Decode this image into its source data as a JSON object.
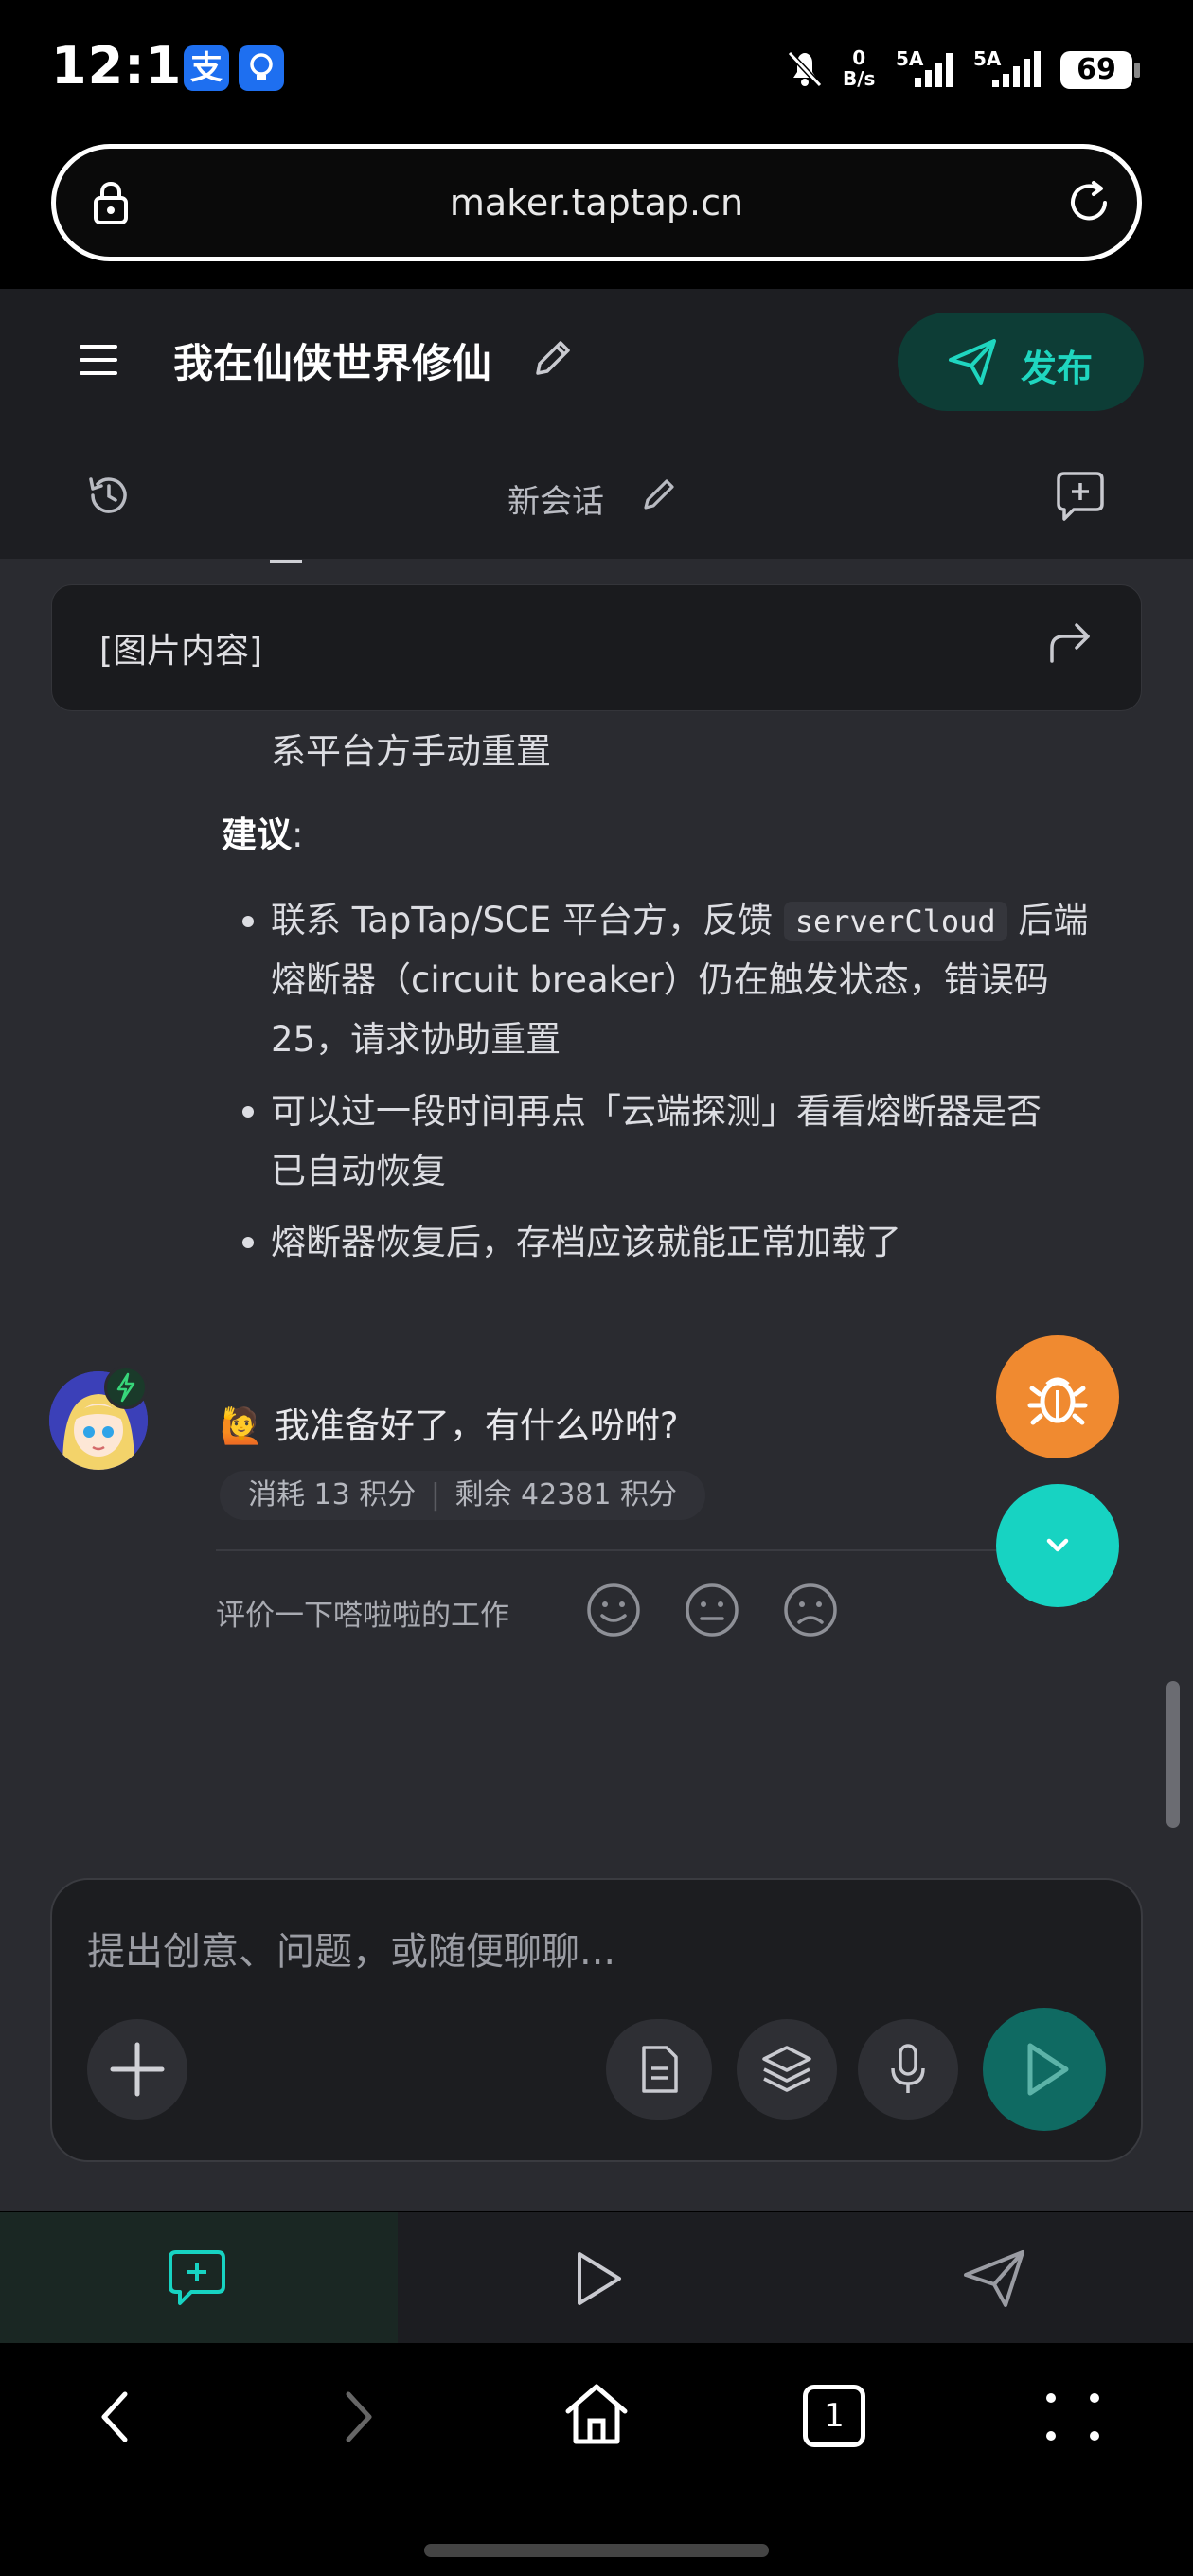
{
  "status_bar": {
    "time": "12:18",
    "app_icons": [
      "支",
      "lightbulb-icon"
    ],
    "net_speed_value": "0",
    "net_speed_unit": "B/s",
    "signal_1_label": "5A",
    "signal_2_label": "5A",
    "battery": "69"
  },
  "browser": {
    "url": "maker.taptap.cn"
  },
  "header": {
    "title": "我在仙侠世界修仙",
    "publish_label": "发布",
    "session_title": "新会话"
  },
  "chat": {
    "image_card_label": "[图片内容]",
    "partial_line": "系平台方手动重置",
    "suggestion_heading": "建议",
    "suggestion_colon": ":",
    "bullets": [
      {
        "line1_before_code": "联系 TapTap/SCE 平台方，反馈",
        "code": "serverCloud",
        "line1_after_code": "后端",
        "line2": "熔断器（circuit breaker）仍在触发状态，错误码",
        "line3": "25，请求协助重置"
      },
      {
        "line1": "可以过一段时间再点「云端探测」看看熔断器是否",
        "line2": "已自动恢复"
      },
      {
        "line1": "熔断器恢复后，存档应该就能正常加载了"
      }
    ],
    "greeting_emoji": "🙋",
    "greeting": "我准备好了，有什么吩咐?",
    "cost_label": "消耗",
    "cost_value": "13",
    "cost_unit": "积分",
    "remain_label": "剩余",
    "remain_value": "42381",
    "remain_unit": "积分",
    "rate_label": "评价一下嗒啦啦的工作"
  },
  "input": {
    "placeholder": "提出创意、问题，或随便聊聊..."
  },
  "system_nav": {
    "tab_count": "1"
  },
  "colors": {
    "accent": "#17d3c2",
    "publish_bg": "#0d3d36",
    "bug_fab": "#f08a30",
    "chat_bg": "#2a2b30",
    "header_bg": "#1d1e22"
  }
}
